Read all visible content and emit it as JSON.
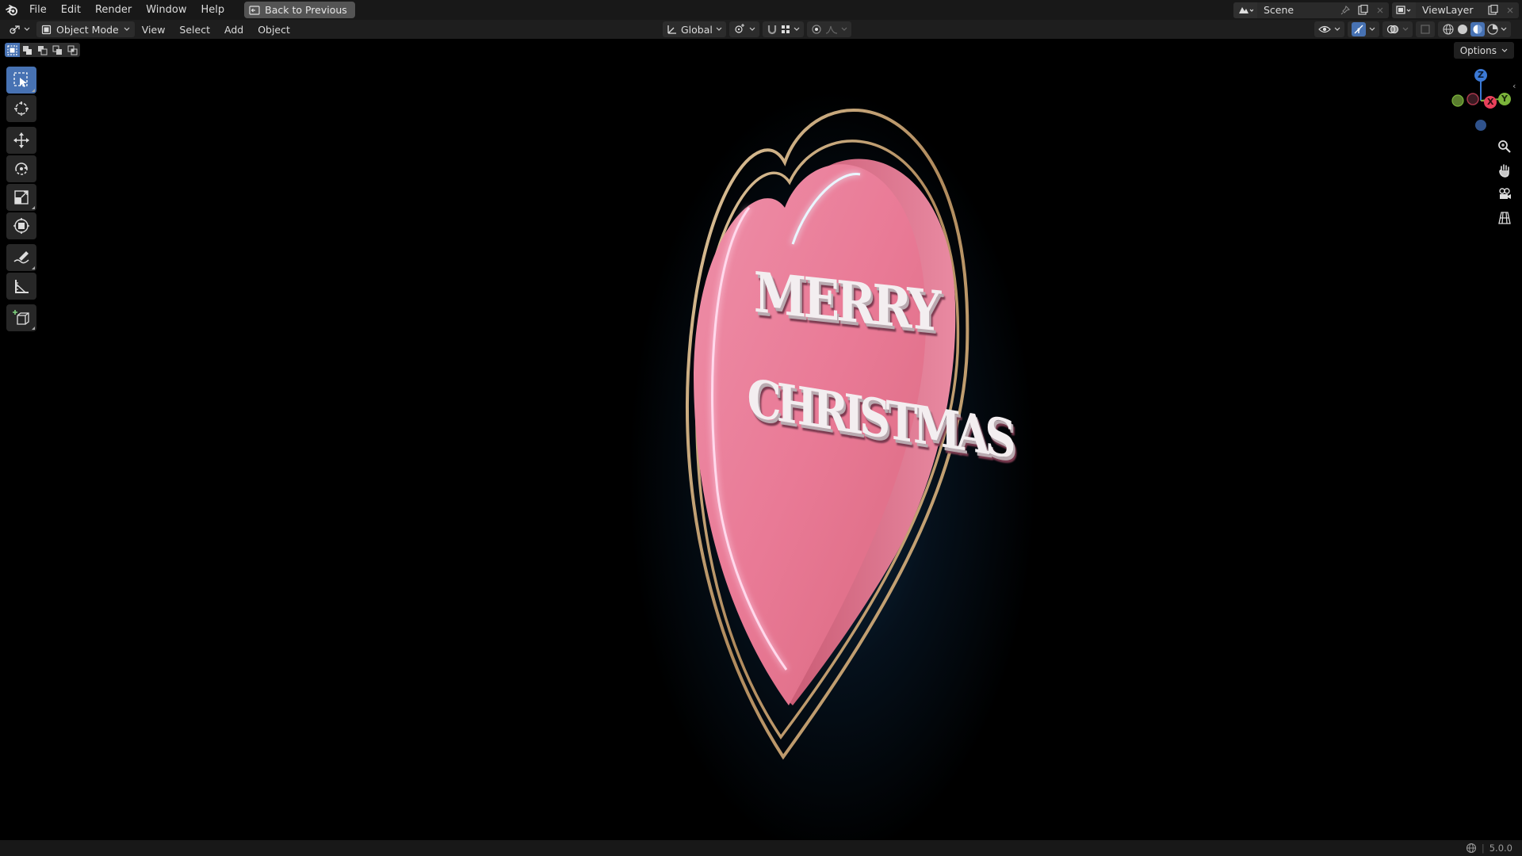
{
  "topbar": {
    "menus": [
      "File",
      "Edit",
      "Render",
      "Window",
      "Help"
    ],
    "back_label": "Back to Previous",
    "scene_name": "Scene",
    "view_layer": "ViewLayer"
  },
  "header": {
    "mode": "Object Mode",
    "menus": [
      "View",
      "Select",
      "Add",
      "Object"
    ],
    "orientation": "Global"
  },
  "viewport": {
    "options_label": "Options",
    "text_line1": "MERRY",
    "text_line2": "CHRISTMAS",
    "gizmo": {
      "z": "Z",
      "x": "X",
      "y": "Y"
    }
  },
  "statusbar": {
    "version": "5.0.0"
  },
  "colors": {
    "accent": "#4772b3",
    "heart_pink": "#e97a96",
    "gold": "#c8a878",
    "axis_x": "#e8405a",
    "axis_y": "#7bb33a",
    "axis_z": "#3b79d6"
  }
}
